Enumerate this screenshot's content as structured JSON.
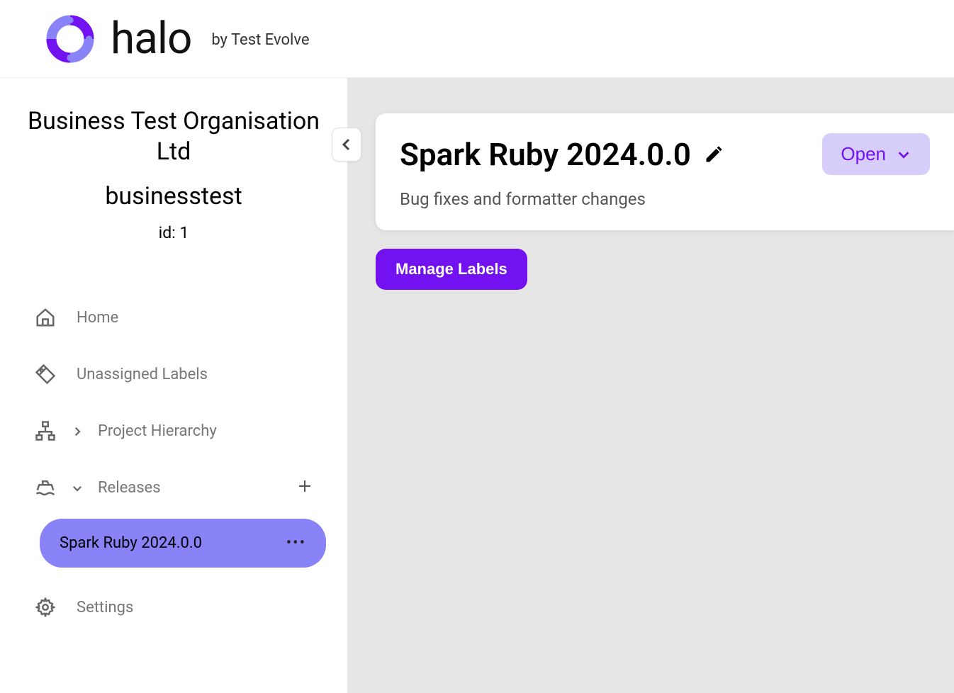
{
  "header": {
    "brand": "halo",
    "byline": "by Test Evolve"
  },
  "sidebar": {
    "org_name": "Business Test Organisation Ltd",
    "org_slug": "businesstest",
    "org_id": "id: 1",
    "nav": {
      "home": "Home",
      "unassigned_labels": "Unassigned Labels",
      "project_hierarchy": "Project Hierarchy",
      "releases": "Releases",
      "settings": "Settings"
    },
    "releases_list": [
      {
        "name": "Spark Ruby 2024.0.0"
      }
    ]
  },
  "main": {
    "release_title": "Spark Ruby 2024.0.0",
    "release_desc": "Bug fixes and formatter changes",
    "status_label": "Open",
    "manage_labels_btn": "Manage Labels"
  }
}
